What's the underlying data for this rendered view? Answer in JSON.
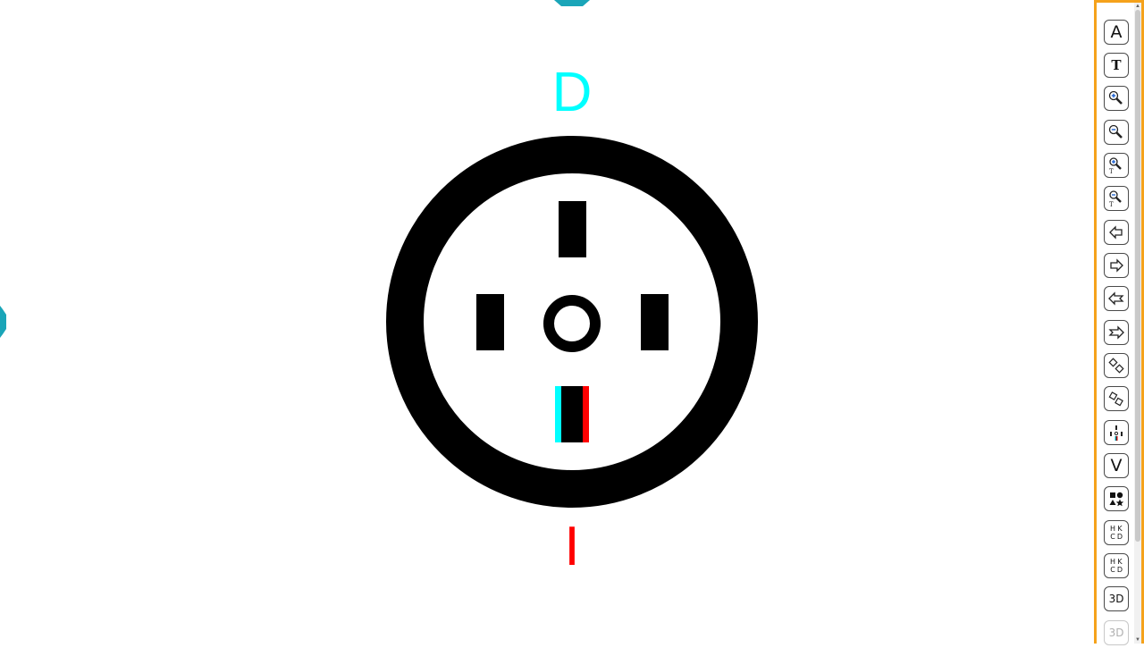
{
  "colors": {
    "accent": "#f5a21b",
    "cyan": "#00ffff",
    "red": "#ff0000",
    "teal": "#1aa5b8",
    "target": "#000000"
  },
  "stage": {
    "label_top": "D",
    "label_bottom": "I"
  },
  "toolbar": {
    "tools": [
      {
        "icon": "letter-a-icon",
        "text": "A"
      },
      {
        "icon": "letter-t-icon",
        "text": "T"
      },
      {
        "icon": "zoom-in-icon",
        "text": ""
      },
      {
        "icon": "zoom-out-icon",
        "text": ""
      },
      {
        "icon": "zoom-in-text-icon",
        "text": ""
      },
      {
        "icon": "zoom-out-text-icon",
        "text": ""
      },
      {
        "icon": "arrow-left-icon",
        "text": ""
      },
      {
        "icon": "arrow-right-icon",
        "text": ""
      },
      {
        "icon": "double-arrow-left-icon",
        "text": ""
      },
      {
        "icon": "double-arrow-right-icon",
        "text": ""
      },
      {
        "icon": "rotate-diamond-left-icon",
        "text": ""
      },
      {
        "icon": "rotate-diamond-right-icon",
        "text": ""
      },
      {
        "icon": "cross-target-icon",
        "text": ""
      },
      {
        "icon": "letter-v-icon",
        "text": "V"
      },
      {
        "icon": "shapes-icon",
        "text": ""
      },
      {
        "icon": "hkcd-chart-alt-icon",
        "text": "HKCD"
      },
      {
        "icon": "hkcd-chart-icon",
        "text": "HKCD"
      },
      {
        "icon": "3d-icon",
        "text": "3D"
      },
      {
        "icon": "3d-dim-icon",
        "text": "3D"
      }
    ]
  }
}
